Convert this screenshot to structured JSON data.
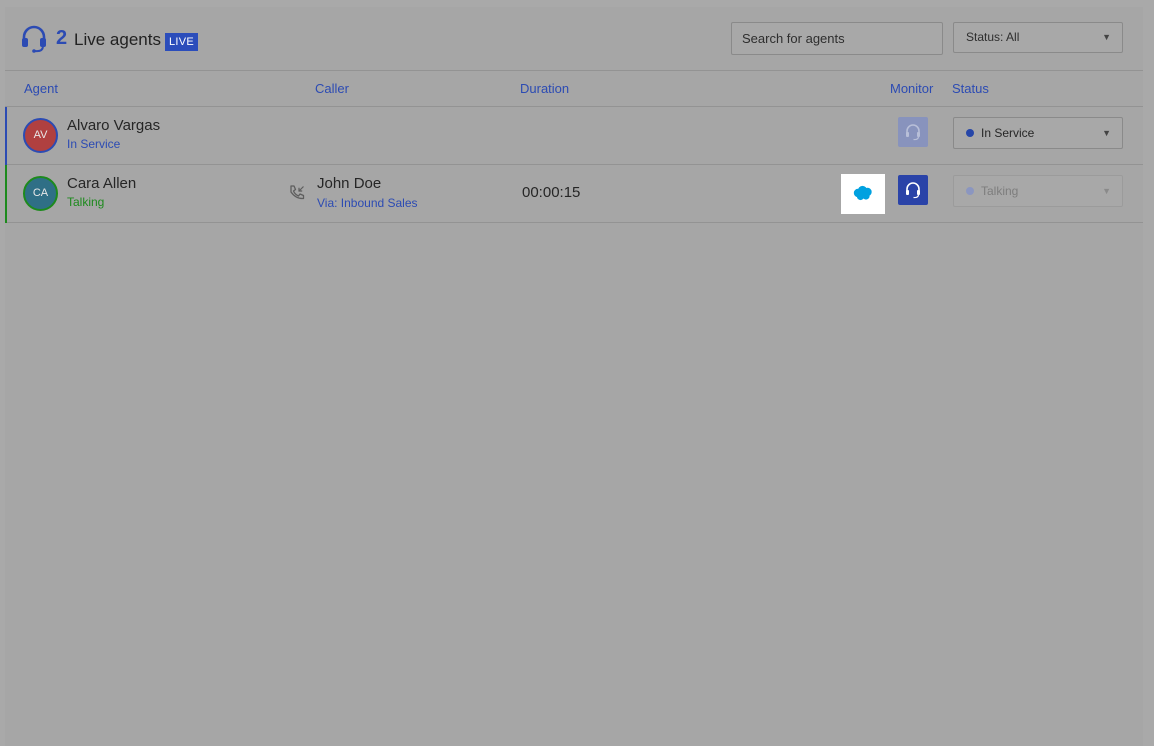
{
  "header": {
    "agent_count": "2",
    "title": "Live agents",
    "live_badge": "LIVE",
    "search_placeholder": "Search for agents",
    "status_filter": "Status: All"
  },
  "columns": {
    "agent": "Agent",
    "caller": "Caller",
    "duration": "Duration",
    "monitor": "Monitor",
    "status": "Status"
  },
  "agents": [
    {
      "initials": "AV",
      "name": "Alvaro Vargas",
      "state": "In Service",
      "state_color": "#2c4bb3",
      "avatar_color": "#b04040",
      "bar_color": "#2c4bb3",
      "caller_name": "",
      "caller_via": "",
      "duration": "",
      "status": "In Service",
      "status_dot_color": "#2646a8",
      "monitor_enabled": false
    },
    {
      "initials": "CA",
      "name": "Cara Allen",
      "state": "Talking",
      "state_color": "#1d8a1d",
      "avatar_color": "#2f6f86",
      "bar_color": "#1d8a1d",
      "caller_name": "John Doe",
      "caller_via": "Via: Inbound Sales",
      "duration": "00:00:15",
      "status": "Talking",
      "status_dot_color": "#8b96c0",
      "monitor_enabled": true,
      "crm_icon": "salesforce-cloud-icon"
    }
  ],
  "colors": {
    "accent": "#2c4bb3",
    "crm": "#00a1e0"
  }
}
